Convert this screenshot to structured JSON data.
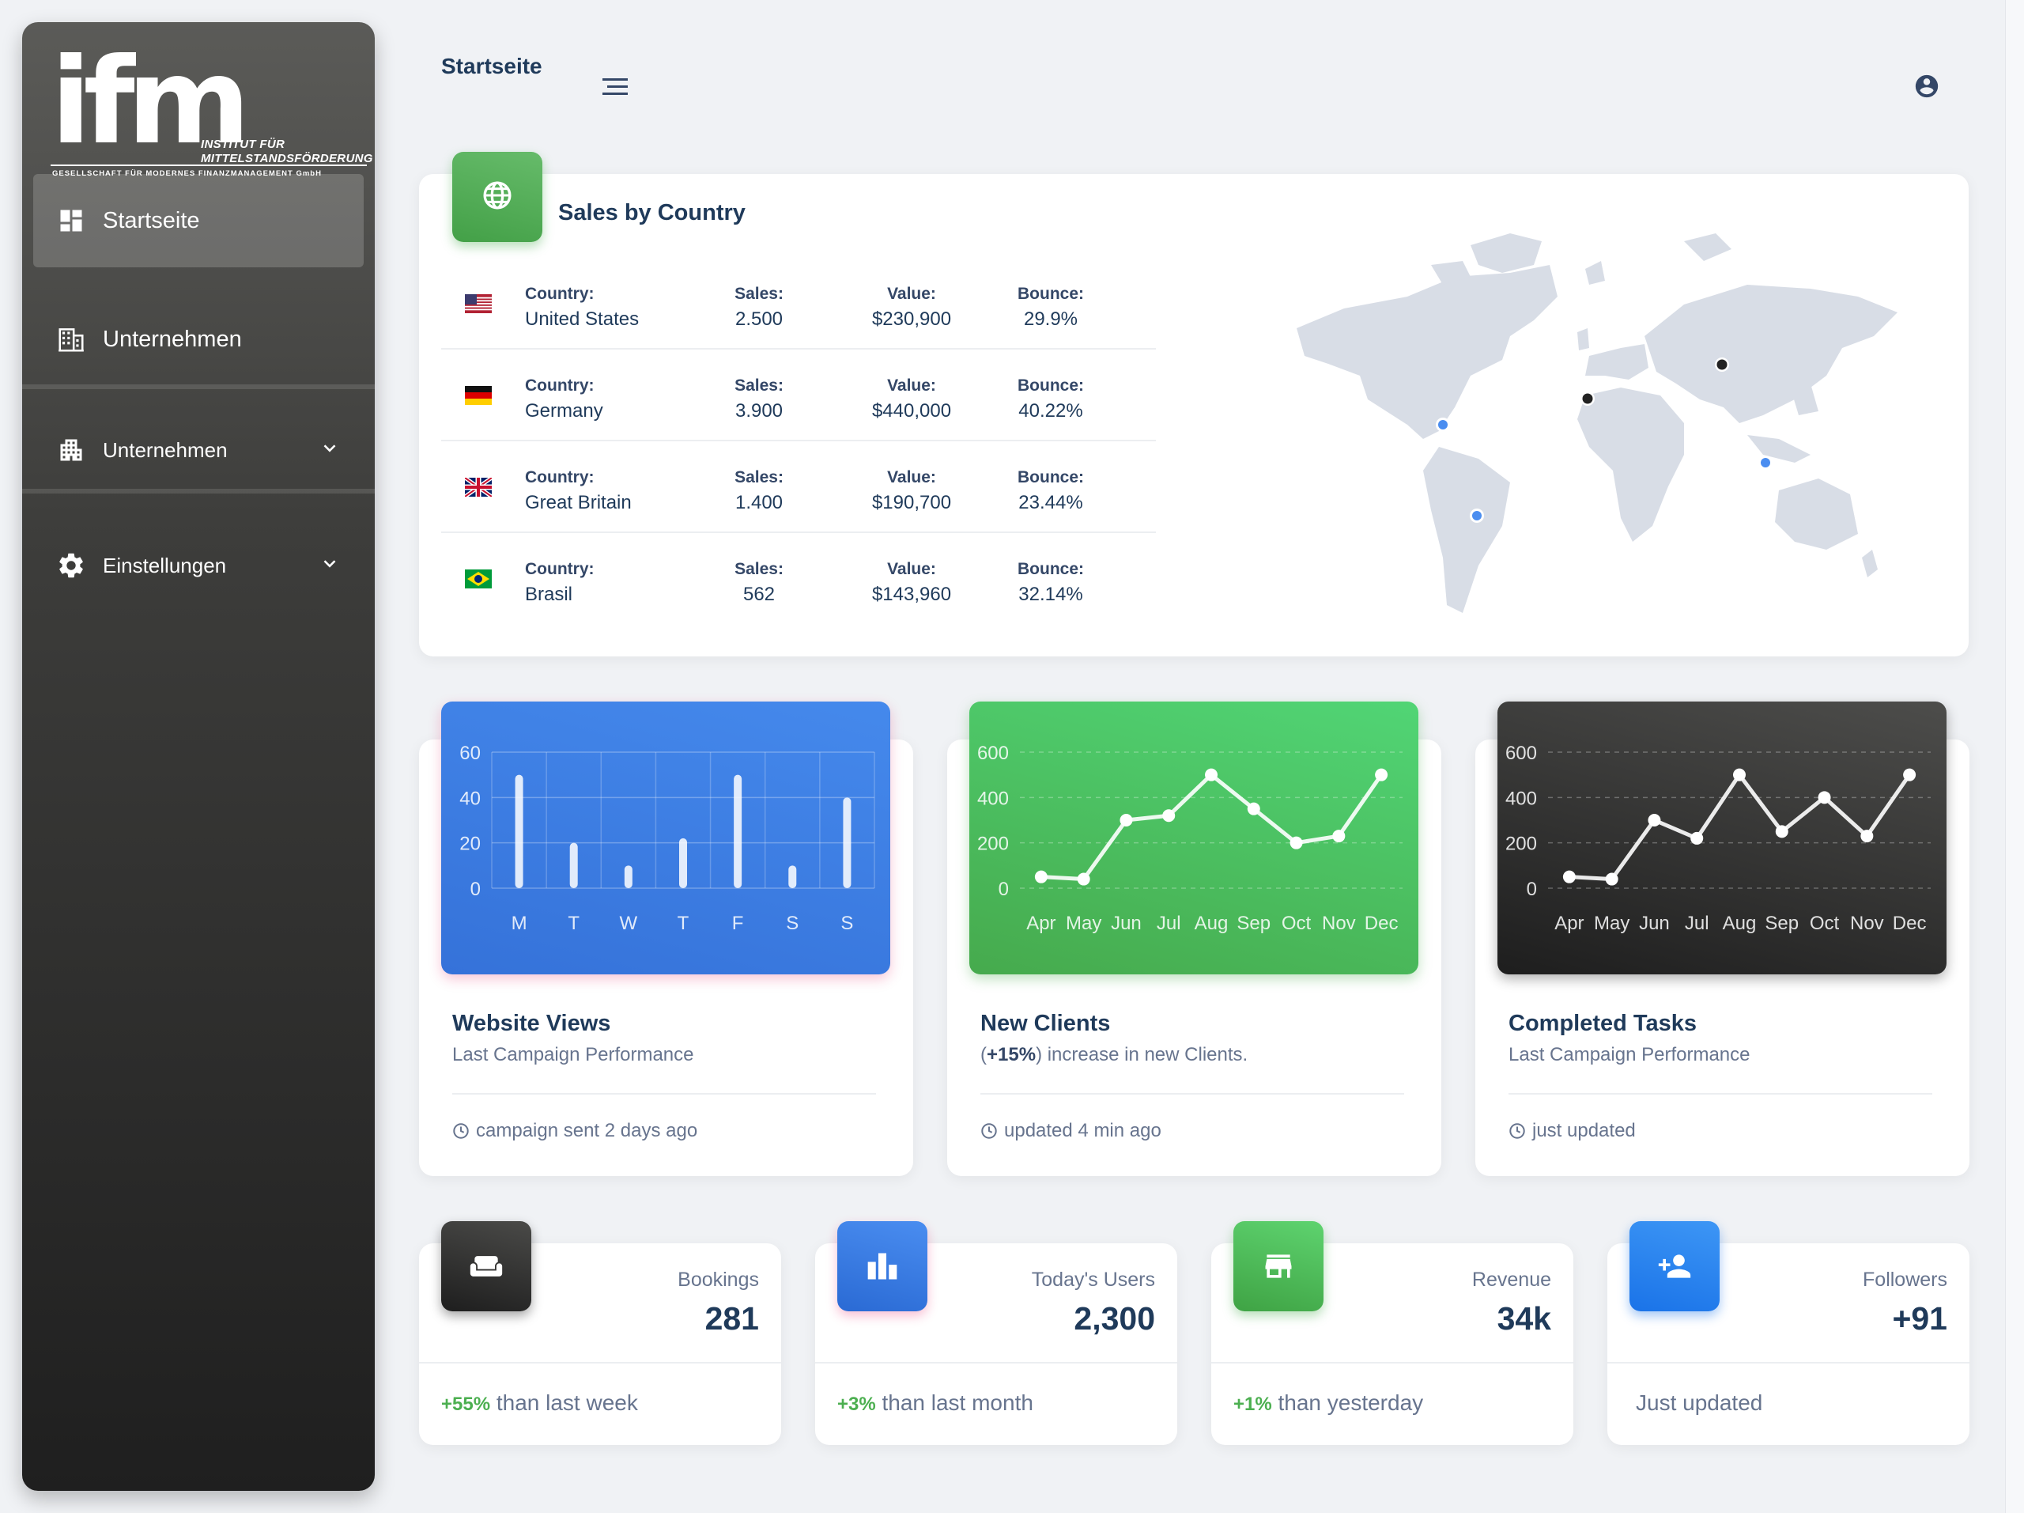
{
  "sidebar": {
    "logo": {
      "letters": "ifm",
      "line1": "INSTITUT FÜR",
      "line2": "MITTELSTANDSFÖRDERUNG",
      "line3": "GESELLSCHAFT FÜR MODERNES FINANZMANAGEMENT GmbH"
    },
    "items": [
      {
        "label": "Startseite",
        "icon": "dashboard-icon",
        "active": true
      },
      {
        "label": "Unternehmen",
        "icon": "building-icon"
      },
      {
        "label": "Unternehmen",
        "icon": "apartment-icon",
        "expandable": true
      },
      {
        "label": "Einstellungen",
        "icon": "gear-icon",
        "expandable": true
      }
    ]
  },
  "topbar": {
    "title": "Startseite"
  },
  "sales": {
    "title": "Sales by Country",
    "keys": {
      "country": "Country:",
      "sales": "Sales:",
      "value": "Value:",
      "bounce": "Bounce:"
    },
    "rows": [
      {
        "country": "United States",
        "sales": "2.500",
        "value": "$230,900",
        "bounce": "29.9%",
        "flag": "us"
      },
      {
        "country": "Germany",
        "sales": "3.900",
        "value": "$440,000",
        "bounce": "40.22%",
        "flag": "de"
      },
      {
        "country": "Great Britain",
        "sales": "1.400",
        "value": "$190,700",
        "bounce": "23.44%",
        "flag": "gb"
      },
      {
        "country": "Brasil",
        "sales": "562",
        "value": "$143,960",
        "bounce": "32.14%",
        "flag": "br"
      }
    ]
  },
  "chart_data": [
    {
      "type": "bar",
      "categories": [
        "M",
        "T",
        "W",
        "T",
        "F",
        "S",
        "S"
      ],
      "values": [
        50,
        20,
        10,
        22,
        50,
        10,
        40
      ],
      "ylim": [
        0,
        60
      ],
      "yticks": [
        "0",
        "20",
        "40",
        "60"
      ],
      "color": "#ffffff",
      "background": "#3b7ee6"
    },
    {
      "type": "line",
      "categories": [
        "Apr",
        "May",
        "Jun",
        "Jul",
        "Aug",
        "Sep",
        "Oct",
        "Nov",
        "Dec"
      ],
      "values": [
        50,
        40,
        300,
        320,
        500,
        350,
        200,
        230,
        500
      ],
      "ylim": [
        0,
        600
      ],
      "yticks": [
        "0",
        "200",
        "400",
        "600"
      ],
      "color": "#ffffff",
      "background": "#4cb950"
    },
    {
      "type": "line",
      "categories": [
        "Apr",
        "May",
        "Jun",
        "Jul",
        "Aug",
        "Sep",
        "Oct",
        "Nov",
        "Dec"
      ],
      "values": [
        50,
        40,
        300,
        220,
        500,
        250,
        400,
        230,
        500
      ],
      "ylim": [
        0,
        600
      ],
      "yticks": [
        "0",
        "200",
        "400",
        "600"
      ],
      "color": "#ffffff",
      "background": "#2f2f2e"
    }
  ],
  "charts": [
    {
      "title": "Website Views",
      "desc": "Last Campaign Performance",
      "foot": "campaign sent 2 days ago"
    },
    {
      "title": "New Clients",
      "desc_bold": "+15%",
      "desc_open": "(",
      "desc_rest": ") increase in new Clients.",
      "foot": "updated 4 min ago"
    },
    {
      "title": "Completed Tasks",
      "desc": "Last Campaign Performance",
      "foot": "just updated"
    }
  ],
  "stats": [
    {
      "label": "Bookings",
      "value": "281",
      "delta": "+55%",
      "foot": " than last week",
      "icon": "weekend-icon",
      "color": "#2d2d2c"
    },
    {
      "label": "Today's Users",
      "value": "2,300",
      "delta": "+3%",
      "foot": " than last month",
      "icon": "leaderboard-icon",
      "color": "#1a73e8"
    },
    {
      "label": "Revenue",
      "value": "34k",
      "delta": "+1%",
      "foot": " than yesterday",
      "icon": "store-icon",
      "color": "#43a047"
    },
    {
      "label": "Followers",
      "value": "+91",
      "delta": "",
      "foot": "Just updated",
      "icon": "person-add-icon",
      "color": "#1a73e8"
    }
  ],
  "colors": {
    "accent_green": "#4caf50",
    "text_dark": "#1f3a5a",
    "text_muted": "#67748e"
  }
}
